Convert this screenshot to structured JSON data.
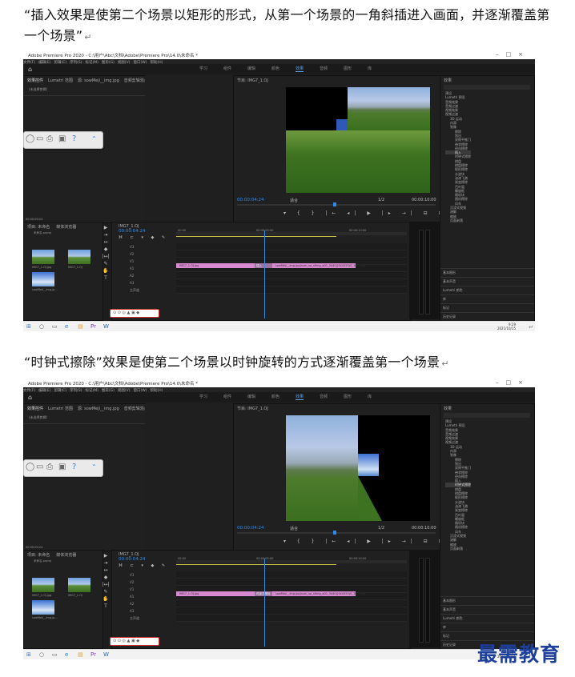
{
  "paragraphs": {
    "p1": "“插入效果是使第二个场景以矩形的形式，从第一个场景的一角斜插进入画面，并逐渐覆盖第一个场景”",
    "p2": "“时钟式擦除”效果是使第二个场景以时钟旋转的方式逐渐覆盖第一个场景",
    "return_mark": "↵"
  },
  "screens": [
    {
      "app_title": "Adobe Premiere Pro 2020 - C:\\用户\\Abc\\文档\\Adobe\\Premiere Pro\\14.0\\未命名 *",
      "menu": [
        "文件(F)",
        "编辑(E)",
        "剪辑(C)",
        "序列(S)",
        "标记(M)",
        "图形(G)",
        "视图(V)",
        "窗口(W)",
        "帮助(H)"
      ],
      "workspaces": [
        "学习",
        "组件",
        "编辑",
        "颜色",
        "效果",
        "音频",
        "图形",
        "库"
      ],
      "active_workspace": "效果",
      "source_tabs": [
        "效果控件",
        "Lumetri 范围",
        "源: sowMeji__img.jpg",
        "音频剪辑混合器: IMG7_1.OJ"
      ],
      "source_empty": "(未选择剪辑)",
      "program_tab": "节目: IMG7_1.OJ",
      "timecode": "00:00:04:24",
      "fit": "适合",
      "ratio": "1/2",
      "duration": "00:00:10:00",
      "project_tabs": [
        "项目: 未命名",
        "媒体浏览器"
      ],
      "project_file": "未命名.prproj",
      "media": [
        "IMG7_1.OJ.jpg",
        "IMG7_1.OJ",
        "sowMeji__img.jp..."
      ],
      "seq_tab": "IMG7_1.OJ",
      "seq_timecode": "00:00:04:24",
      "ruler": [
        "00:00",
        "00:00:05:00",
        "00:00:10:00"
      ],
      "tracks": [
        "V3",
        "V2",
        "V1",
        "A1",
        "A2",
        "A3",
        "主声道"
      ],
      "clip_a": "IMG7_1.OJ.jpg",
      "clip_b": "sowMeji__img.jpg(sum_sp_sfimg_a01_3440)(S44325)S_1000.jpg",
      "transition": "插入",
      "effects_tab": "效果",
      "effects_tree": [
        "预设",
        "Lumetri 预设",
        "音频效果",
        "音频过渡",
        "视频效果",
        "视频过渡",
        "3D 运动",
        "内滑",
        "划像",
        "擦除",
        "划出",
        "双侧平推门",
        "带状擦除",
        "径向擦除",
        "插入",
        "时钟式擦除",
        "棋盘",
        "棋盘擦除",
        "楔形擦除",
        "水波块",
        "油漆飞溅",
        "渐变擦除",
        "百叶窗",
        "螺旋框",
        "随机块",
        "随机擦除",
        "风车",
        "沉浸式视频",
        "溶解",
        "缩放",
        "页面剥落"
      ],
      "highlight": "插入",
      "bottom_sections": [
        "基本图形",
        "基本声音",
        "Lumetri 颜色",
        "库",
        "标记",
        "历史记录",
        "信息"
      ],
      "clock": "9:29",
      "date": "2021/10/15",
      "extra": {
        "timecode_left": "00:00:00:24"
      }
    },
    {
      "app_title": "Adobe Premiere Pro 2020 - C:\\用户\\Abc\\文档\\Adobe\\Premiere Pro\\14.0\\未命名 *",
      "menu": [
        "文件(F)",
        "编辑(E)",
        "剪辑(C)",
        "序列(S)",
        "标记(M)",
        "图形(G)",
        "视图(V)",
        "窗口(W)",
        "帮助(H)"
      ],
      "workspaces": [
        "学习",
        "组件",
        "编辑",
        "颜色",
        "效果",
        "音频",
        "图形",
        "库"
      ],
      "active_workspace": "效果",
      "source_tabs": [
        "效果控件",
        "Lumetri 范围",
        "源: sowMeji__img.jpg",
        "音频剪辑混合器: IMG7_1.OJ"
      ],
      "source_empty": "(未选择剪辑)",
      "program_tab": "节目: IMG7_1.OJ",
      "timecode": "00:00:04:24",
      "fit": "适合",
      "ratio": "1/2",
      "duration": "00:00:10:00",
      "project_tabs": [
        "项目: 未命名",
        "媒体浏览器"
      ],
      "project_file": "未命名.prproj",
      "media": [
        "IMG7_1.OJ.jpg",
        "IMG7_1.OJ",
        "sowMeji__img.jp..."
      ],
      "seq_tab": "IMG7_1.OJ",
      "seq_timecode": "00:00:04:24",
      "ruler": [
        "00:00",
        "00:00:05:00",
        "00:00:10:00"
      ],
      "tracks": [
        "V3",
        "V2",
        "V1",
        "A1",
        "A2",
        "A3",
        "主声道"
      ],
      "clip_a": "IMG7_1.OJ.jpg",
      "clip_b": "sowMeji__img.jpg(sum_sp_sfimg_a01_3440)(S44325)S_1000.jpg",
      "transition": "时钟式擦除",
      "effects_tab": "效果",
      "effects_tree": [
        "预设",
        "Lumetri 预设",
        "音频效果",
        "音频过渡",
        "视频效果",
        "视频过渡",
        "3D 运动",
        "内滑",
        "划像",
        "擦除",
        "划出",
        "双侧平推门",
        "带状擦除",
        "径向擦除",
        "插入",
        "时钟式擦除",
        "棋盘",
        "棋盘擦除",
        "楔形擦除",
        "水波块",
        "油漆飞溅",
        "渐变擦除",
        "百叶窗",
        "螺旋框",
        "随机块",
        "随机擦除",
        "风车",
        "沉浸式视频",
        "溶解",
        "缩放",
        "页面剥落"
      ],
      "highlight": "时钟式擦除",
      "bottom_sections": [
        "基本图形",
        "基本声音",
        "Lumetri 颜色",
        "库",
        "标记",
        "历史记录",
        "信息"
      ],
      "clock": "9:29",
      "date": "2021/10/15",
      "extra": {
        "timecode_left": "00:00:00:24"
      }
    }
  ],
  "watermark": "最需教育",
  "colors": {
    "accent": "#2d8ceb",
    "clip": "#d88ad0",
    "watermark": "#1d3f9c"
  }
}
